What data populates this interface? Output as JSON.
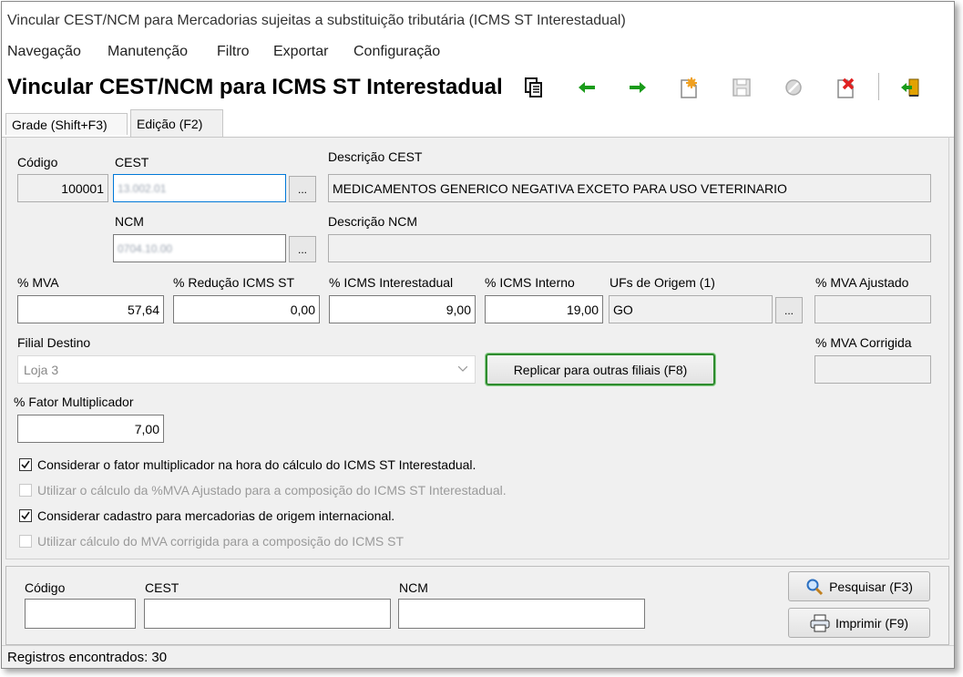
{
  "window": {
    "title": "Vincular CEST/NCM para Mercadorias sujeitas a substituição tributária (ICMS ST Interestadual)"
  },
  "menu": [
    "Navegação",
    "Manutenção",
    "Filtro",
    "Exportar",
    "Configuração"
  ],
  "header": {
    "title": "Vincular CEST/NCM para ICMS ST Interestadual"
  },
  "toolbar": {
    "icons": [
      "copy-icon",
      "arrow-left-icon",
      "arrow-right-icon",
      "new-record-icon",
      "save-icon",
      "cancel-icon",
      "delete-icon",
      "exit-icon"
    ],
    "colors": {
      "arrows": "#1a9b1a",
      "new": "#f0a020",
      "delete": "#e02020"
    }
  },
  "tabs": [
    {
      "label": "Grade (Shift+F3)"
    },
    {
      "label": "Edição (F2)",
      "active": true
    }
  ],
  "form": {
    "codigo": {
      "label": "Código",
      "value": "100001"
    },
    "cest": {
      "label": "CEST",
      "value": "13.002.01",
      "button": "..."
    },
    "descricao_cest": {
      "label": "Descrição CEST",
      "value": "MEDICAMENTOS GENERICO NEGATIVA EXCETO PARA USO VETERINARIO"
    },
    "ncm": {
      "label": "NCM",
      "value": "0704.10.00",
      "button": "..."
    },
    "descricao_ncm": {
      "label": "Descrição NCM",
      "value": ""
    },
    "mva": {
      "label": "% MVA",
      "value": "57,64"
    },
    "reducao": {
      "label": "% Redução ICMS ST",
      "value": "0,00"
    },
    "icms_inter": {
      "label": "% ICMS Interestadual",
      "value": "9,00"
    },
    "icms_interno": {
      "label": "% ICMS Interno",
      "value": "19,00"
    },
    "ufs": {
      "label": "UFs de Origem (1)",
      "value": "GO",
      "button": "..."
    },
    "mva_ajustado": {
      "label": "% MVA Ajustado",
      "value": ""
    },
    "filial": {
      "label": "Filial Destino",
      "value": "Loja 3"
    },
    "replicar": {
      "label": "Replicar para outras filiais (F8)"
    },
    "mva_corrigida": {
      "label": "% MVA Corrigida",
      "value": ""
    },
    "fator": {
      "label": "% Fator Multiplicador",
      "value": "7,00"
    }
  },
  "checkboxes": [
    {
      "label": "Considerar o fator multiplicador na hora do cálculo do ICMS ST Interestadual.",
      "checked": true,
      "enabled": true
    },
    {
      "label": "Utilizar o cálculo da %MVA Ajustado para a composição do ICMS ST Interestadual.",
      "checked": false,
      "enabled": false
    },
    {
      "label": "Considerar cadastro para mercadorias de origem internacional.",
      "checked": true,
      "enabled": true
    },
    {
      "label": "Utilizar cálculo do MVA corrigida para a composição do ICMS ST",
      "checked": false,
      "enabled": false
    }
  ],
  "search": {
    "codigo_label": "Código",
    "cest_label": "CEST",
    "ncm_label": "NCM",
    "pesquisar": "Pesquisar (F3)",
    "imprimir": "Imprimir (F9)"
  },
  "status": {
    "text": "Registros encontrados: 30"
  }
}
